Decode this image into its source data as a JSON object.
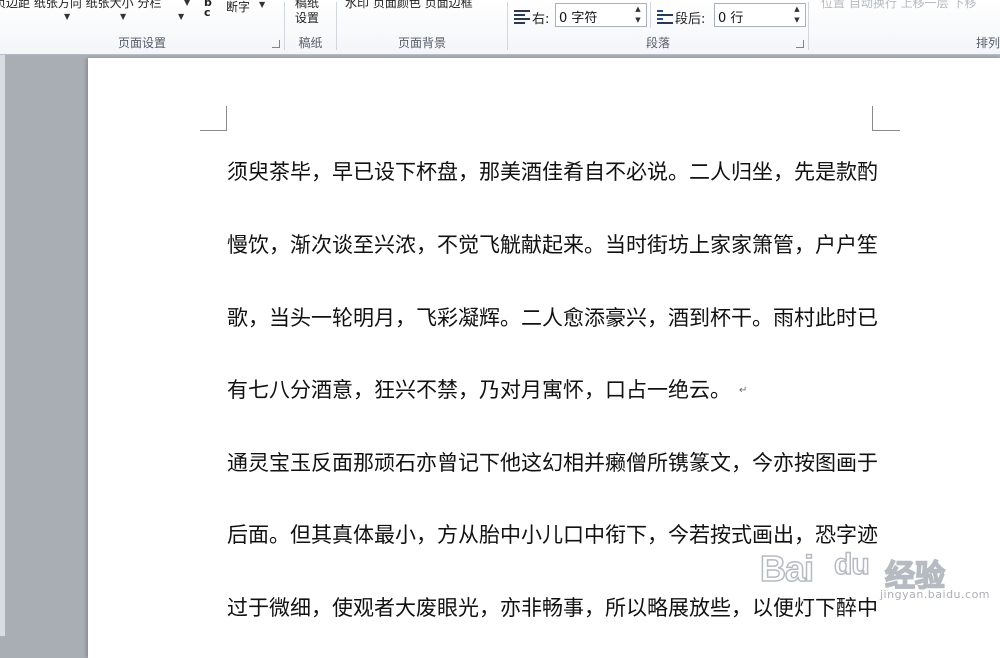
{
  "ribbon": {
    "page_setup": {
      "clipped_top": "页边距 纸张方向 纸张大小 分栏",
      "hyphenation_label": "断字",
      "hyphenation_icon": "bc-hyphenation-icon",
      "group_label": "页面设置"
    },
    "draft": {
      "clipped_top": "稿纸",
      "button_label": "设置",
      "group_label": "稿纸"
    },
    "page_background": {
      "clipped_top": "水印 页面颜色 页面边框",
      "group_label": "页面背景"
    },
    "paragraph": {
      "indent_right_label": "右:",
      "indent_right_value": "0 字符",
      "spacing_after_label": "段后:",
      "spacing_after_value": "0 行",
      "group_label": "段落"
    },
    "arrange": {
      "clipped_top": "位置  自动换行 上移一层 下移",
      "group_label": "排列"
    }
  },
  "document": {
    "lines": [
      "须臾茶毕，早已设下杯盘，那美酒佳肴自不必说。二人归坐，先是款酌",
      "慢饮，渐次谈至兴浓，不觉飞觥献起来。当时街坊上家家箫管，户户笙",
      "歌，当头一轮明月，飞彩凝辉。二人愈添豪兴，酒到杯干。雨村此时已",
      "有七八分酒意，狂兴不禁，乃对月寓怀，口占一绝云。",
      "通灵宝玉反面那顽石亦曾记下他这幻相并癞僧所镌篆文，今亦按图画于",
      "后面。但其真体最小，方从胎中小儿口中衔下，今若按式画出，恐字迹",
      "过于微细，使观者大废眼光，亦非畅事，所以略展放些，以便灯下醉中"
    ],
    "paragraph_mark": "↵"
  },
  "watermark": {
    "text": "Bai",
    "text2": "du",
    "text_cn": "经验",
    "url": "jingyan.baidu.com"
  }
}
